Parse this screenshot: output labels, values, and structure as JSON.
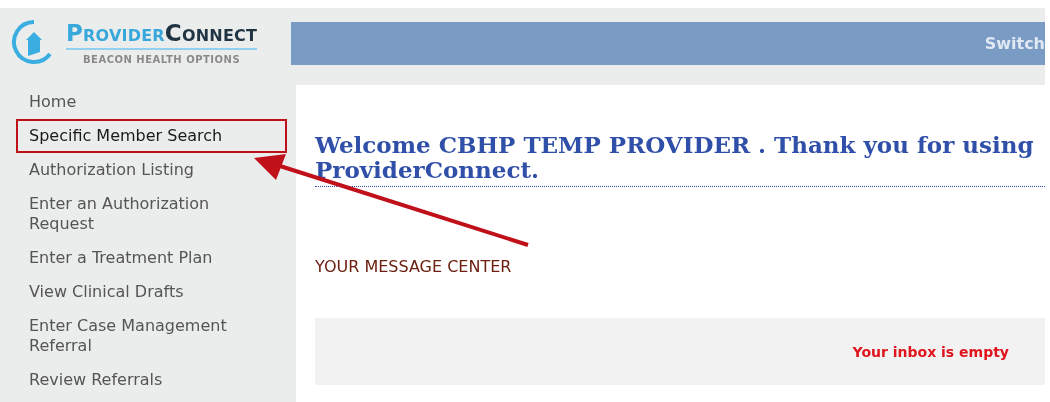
{
  "logo": {
    "name_first": "Provider",
    "name_second": "Connect",
    "tagline": "BEACON HEALTH OPTIONS"
  },
  "top_bar": {
    "link": "Switch"
  },
  "sidebar": {
    "items": [
      {
        "label": "Home",
        "highlighted": false
      },
      {
        "label": "Specific Member Search",
        "highlighted": true
      },
      {
        "label": "Authorization Listing",
        "highlighted": false
      },
      {
        "label": "Enter an Authorization Request",
        "highlighted": false
      },
      {
        "label": "Enter a Treatment Plan",
        "highlighted": false
      },
      {
        "label": "View Clinical Drafts",
        "highlighted": false
      },
      {
        "label": "Enter Case Management Referral",
        "highlighted": false
      },
      {
        "label": "Review Referrals",
        "highlighted": false
      }
    ]
  },
  "content": {
    "welcome_line_1": "Welcome CBHP TEMP PROVIDER . Thank you for using",
    "welcome_line_2": "ProviderConnect.",
    "message_center_title": "YOUR MESSAGE CENTER",
    "inbox_status": "Your inbox is empty"
  },
  "annotation": {
    "arrow": true
  }
}
